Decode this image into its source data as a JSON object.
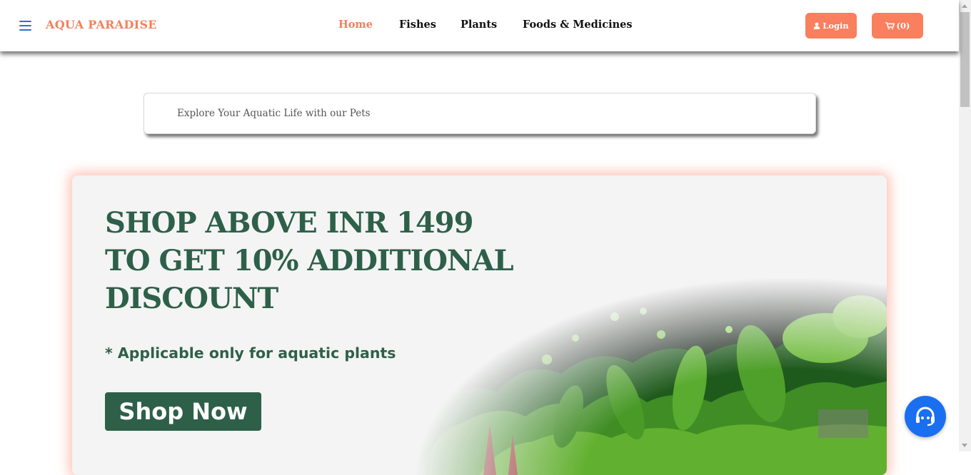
{
  "header": {
    "brand": "AQUA PARADISE",
    "nav": [
      {
        "label": "Home",
        "active": true
      },
      {
        "label": "Fishes",
        "active": false
      },
      {
        "label": "Plants",
        "active": false
      },
      {
        "label": "Foods & Medicines",
        "active": false
      }
    ],
    "login_label": "Login",
    "cart_label": "(0)"
  },
  "search": {
    "placeholder": "Explore Your Aquatic Life with our Pets"
  },
  "banner": {
    "headline": "SHOP ABOVE INR 1499 TO GET  10% ADDITIONAL DISCOUNT",
    "subtext": "* Applicable only for aquatic plants",
    "cta_label": "Shop Now"
  },
  "icons": {
    "menu": "hamburger-icon",
    "login": "user-icon",
    "cart": "shopping-cart-icon",
    "support": "headset-support-icon"
  },
  "colors": {
    "accent": "#f97f5e",
    "brand_text": "#f47f5c",
    "banner_green": "#2e6049",
    "support_blue": "#1a6ff0",
    "menu_blue": "#2e6fd0"
  }
}
